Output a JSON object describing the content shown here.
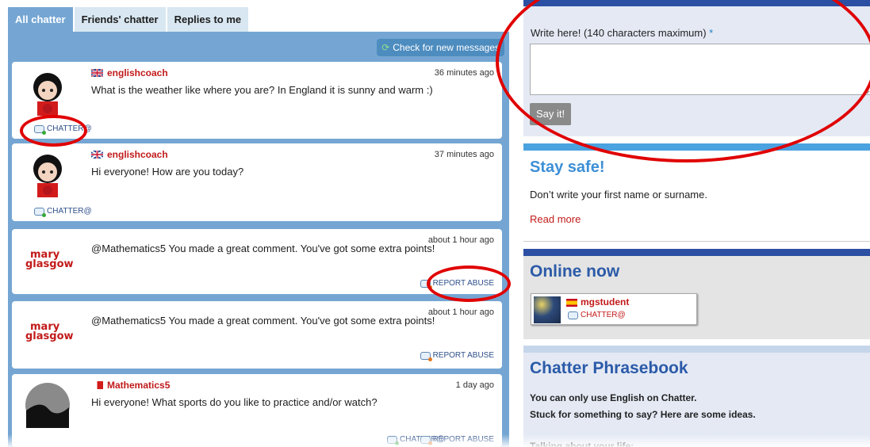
{
  "tabs": [
    {
      "label": "All chatter"
    },
    {
      "label": "Friends' chatter"
    },
    {
      "label": "Replies to me"
    }
  ],
  "feed": {
    "check_label": "Check for new messages",
    "messages": [
      {
        "user": "englishcoach",
        "time": "36 minutes ago",
        "text": "What is the weather like where you are? In England it is sunny and warm :)",
        "link": "CHATTER@"
      },
      {
        "user": "englishcoach",
        "time": "37 minutes ago",
        "text": "Hi everyone! How are you today?",
        "link": "CHATTER@"
      },
      {
        "user": "",
        "time": "about 1 hour ago",
        "text": "@Mathematics5 You made a great comment. You've got some extra points!",
        "link": "REPORT ABUSE"
      },
      {
        "user": "",
        "time": "about 1 hour ago",
        "text": "@Mathematics5 You made a great comment. You've got some extra points!",
        "link": "REPORT ABUSE"
      },
      {
        "user": "Mathematics5",
        "time": "1 day ago",
        "text": "Hi everyone! What sports do you like to practice and/or watch?",
        "link": "CHATTER@",
        "link2": "REPORT ABUSE"
      }
    ],
    "brand_line1": "mary",
    "brand_line2": "glasgow"
  },
  "write": {
    "label": "Write here! (140 characters maximum)",
    "required_mark": "*",
    "button_label": "Say it!",
    "value": ""
  },
  "safe": {
    "title": "Stay safe!",
    "text": "Don’t write your first name or surname.",
    "more": "Read more"
  },
  "online": {
    "title": "Online now",
    "user": "mgstudent",
    "link": "CHATTER@"
  },
  "phrasebook": {
    "title": "Chatter Phrasebook",
    "line1": "You can only use English on Chatter.",
    "line2": "Stuck for something to say? Here are some ideas.",
    "line3": "Talking about your life:"
  },
  "colors": {
    "accent_blue": "#75a6d3",
    "username_red": "#c21a1a",
    "highlight_circle": "#e00000"
  }
}
